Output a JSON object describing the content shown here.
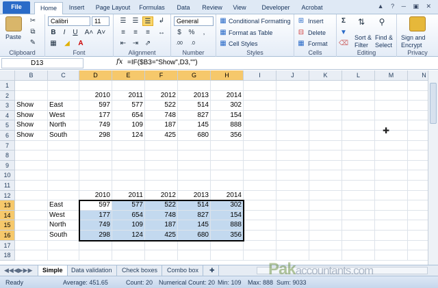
{
  "ribbon_tabs": [
    "File",
    "Home",
    "Insert",
    "Page Layout",
    "Formulas",
    "Data",
    "Review",
    "View",
    "Developer",
    "Acrobat"
  ],
  "clipboard": {
    "paste": "Paste",
    "label": "Clipboard"
  },
  "font": {
    "name": "Calibri",
    "size": "11",
    "label": "Font"
  },
  "alignment": {
    "label": "Alignment"
  },
  "number": {
    "format": "General",
    "label": "Number"
  },
  "styles": {
    "conditional": "Conditional Formatting",
    "format_table": "Format as Table",
    "cell_styles": "Cell Styles",
    "label": "Styles"
  },
  "cells": {
    "insert": "Insert",
    "delete": "Delete",
    "format": "Format",
    "label": "Cells"
  },
  "editing": {
    "sort1": "Sort &",
    "sort2": "Filter",
    "find1": "Find &",
    "find2": "Select",
    "label": "Editing"
  },
  "privacy": {
    "sign1": "Sign and",
    "sign2": "Encrypt",
    "label": "Privacy"
  },
  "formula_bar": {
    "name_box": "D13",
    "fx": "fx",
    "formula": "=IF($B3=\"Show\",D3,\"\")"
  },
  "columns": [
    "B",
    "C",
    "D",
    "E",
    "F",
    "G",
    "H",
    "I",
    "J",
    "K",
    "L",
    "M",
    "N"
  ],
  "rows": [
    "1",
    "2",
    "3",
    "4",
    "5",
    "6",
    "7",
    "8",
    "9",
    "10",
    "11",
    "12",
    "13",
    "14",
    "15",
    "16",
    "17",
    "18"
  ],
  "grid": {
    "2": {
      "D": "2010",
      "E": "2011",
      "F": "2012",
      "G": "2013",
      "H": "2014"
    },
    "3": {
      "B": "Show",
      "C": "East",
      "D": "597",
      "E": "577",
      "F": "522",
      "G": "514",
      "H": "302"
    },
    "4": {
      "B": "Show",
      "C": "West",
      "D": "177",
      "E": "654",
      "F": "748",
      "G": "827",
      "H": "154"
    },
    "5": {
      "B": "Show",
      "C": "North",
      "D": "749",
      "E": "109",
      "F": "187",
      "G": "145",
      "H": "888"
    },
    "6": {
      "B": "Show",
      "C": "South",
      "D": "298",
      "E": "124",
      "F": "425",
      "G": "680",
      "H": "356"
    },
    "12": {
      "D": "2010",
      "E": "2011",
      "F": "2012",
      "G": "2013",
      "H": "2014"
    },
    "13": {
      "C": "East",
      "D": "597",
      "E": "577",
      "F": "522",
      "G": "514",
      "H": "302"
    },
    "14": {
      "C": "West",
      "D": "177",
      "E": "654",
      "F": "748",
      "G": "827",
      "H": "154"
    },
    "15": {
      "C": "North",
      "D": "749",
      "E": "109",
      "F": "187",
      "G": "145",
      "H": "888"
    },
    "16": {
      "C": "South",
      "D": "298",
      "E": "124",
      "F": "425",
      "G": "680",
      "H": "356"
    }
  },
  "sheet_tabs": [
    "Simple",
    "Data validation",
    "Check boxes",
    "Combo box"
  ],
  "status": {
    "ready": "Ready",
    "average": "Average: 451.65",
    "count": "Count: 20",
    "numerical_count": "Numerical Count: 20",
    "min": "Min: 109",
    "max": "Max: 888",
    "sum": "Sum: 9033"
  },
  "watermark": {
    "brand": "Pak",
    "rest": "accountants.com"
  }
}
